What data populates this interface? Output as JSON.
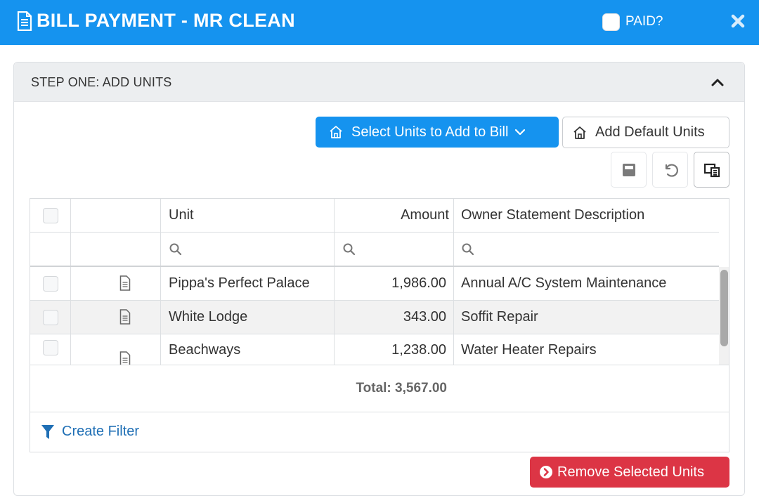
{
  "header": {
    "title": "BILL PAYMENT - MR CLEAN",
    "paid_label": "PAID?",
    "paid_checked": false,
    "bg_color": "#1593ef"
  },
  "panel": {
    "step_title": "STEP ONE: ADD UNITS",
    "select_units_label": "Select Units to Add to Bill",
    "add_default_label": "Add Default Units",
    "remove_label": "Remove Selected Units",
    "remove_color": "#dc3545"
  },
  "grid": {
    "columns": [
      "Unit",
      "Amount",
      "Owner Statement Description"
    ],
    "rows": [
      {
        "unit": "Pippa's Perfect Palace",
        "amount": "1,986.00",
        "description": "Annual A/C System Maintenance"
      },
      {
        "unit": "White Lodge",
        "amount": "343.00",
        "description": "Soffit Repair"
      },
      {
        "unit": "Beachways",
        "amount": "1,238.00",
        "description": "Water Heater Repairs"
      }
    ],
    "total_label": "Total: 3,567.00",
    "create_filter_label": "Create Filter"
  },
  "icons": {
    "header": [
      "document-icon",
      "close-icon"
    ],
    "toolbar": [
      "save-icon",
      "undo-icon",
      "column-chooser-icon"
    ],
    "filter_row": "search-icon",
    "row": "document-icon",
    "filter": "funnel-icon",
    "remove": "chevron-circle-right-icon"
  }
}
